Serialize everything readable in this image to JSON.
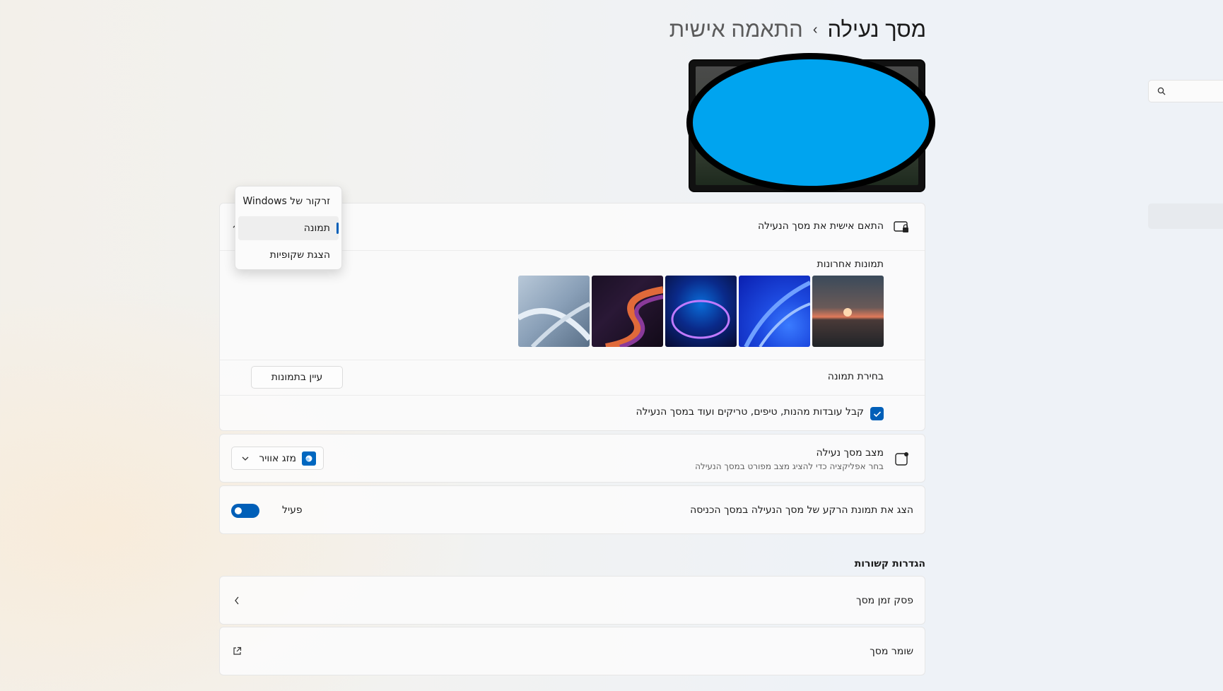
{
  "header": {
    "breadcrumb_parent": "התאמה אישית",
    "breadcrumb_separator": "›",
    "page_title": "מסך נעילה"
  },
  "personalize": {
    "label": "התאם אישית את מסך הנעילה",
    "dropdown_options": [
      "זרקור של Windows",
      "תמונה",
      "הצגת שקופיות"
    ],
    "dropdown_selected": "תמונה",
    "recent_images_label": "תמונות אחרונות",
    "recent_images": [
      "sunset-lake",
      "blue-bloom",
      "glow-orb",
      "ribbon-swirl",
      "grey-bloom"
    ],
    "choose_photo_label": "בחירת תמונה",
    "browse_button": "עיין בתמונות",
    "fun_facts_label": "קבל עובדות מהנות, טיפים, טריקים ועוד במסך הנעילה",
    "fun_facts_checked": true
  },
  "lock_status": {
    "label": "מצב מסך נעילה",
    "description": "בחר אפליקציה כדי להציג מצב מפורט במסך הנעילה",
    "selected_app": "מזג אוויר"
  },
  "signin_bg": {
    "label": "הצג את תמונת הרקע של מסך הנעילה במסך הכניסה",
    "toggle_state": "פעיל",
    "toggle_on": true
  },
  "related": {
    "title": "הגדרות קשורות",
    "items": [
      {
        "label": "פסק זמן מסך",
        "icon": "chevron-left-icon"
      },
      {
        "label": "שומר מסך",
        "icon": "external-link-icon"
      }
    ]
  },
  "colors": {
    "accent": "#005fb8",
    "blob": "#00a4ef"
  }
}
